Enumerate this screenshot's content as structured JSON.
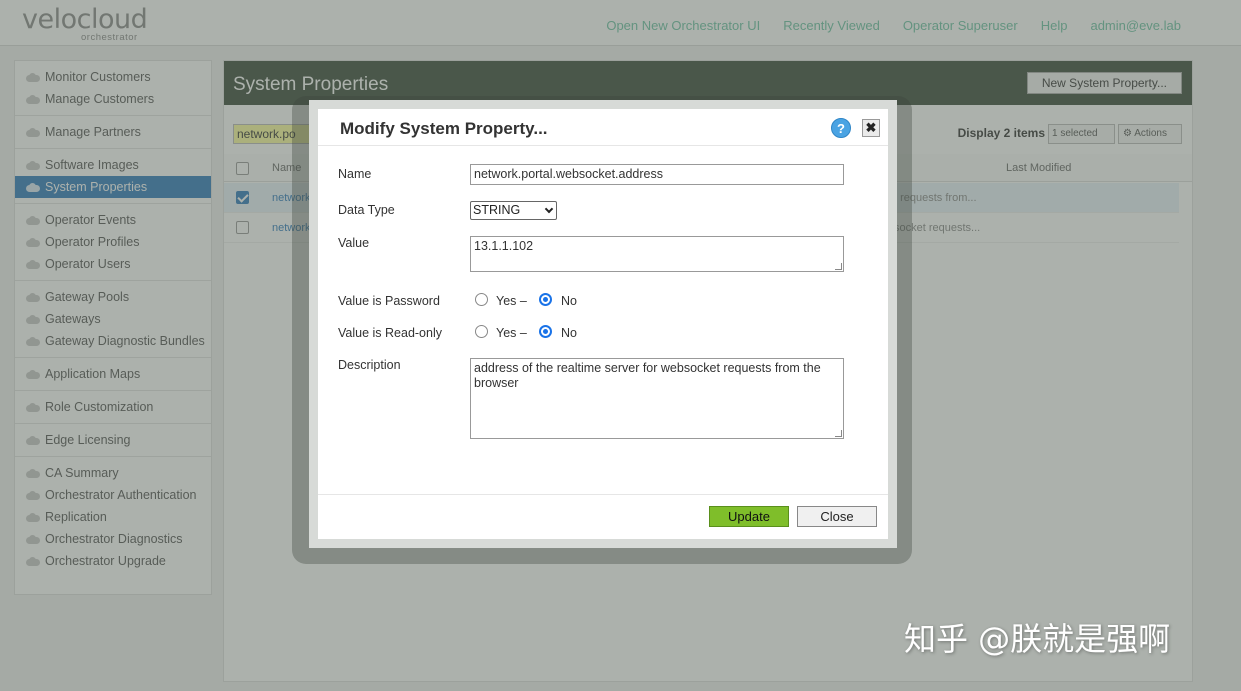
{
  "header": {
    "logo_main": "velocloud",
    "logo_sub": "orchestrator",
    "nav": [
      "Open New Orchestrator UI",
      "Recently Viewed",
      "Operator Superuser",
      "Help",
      "admin@eve.lab"
    ]
  },
  "sidebar": {
    "groups": [
      [
        "Monitor Customers",
        "Manage Customers"
      ],
      [
        "Manage Partners"
      ],
      [
        "Software Images",
        "System Properties"
      ],
      [
        "Operator Events",
        "Operator Profiles",
        "Operator Users"
      ],
      [
        "Gateway Pools",
        "Gateways",
        "Gateway Diagnostic Bundles"
      ],
      [
        "Application Maps"
      ],
      [
        "Role Customization"
      ],
      [
        "Edge Licensing"
      ],
      [
        "CA Summary",
        "Orchestrator Authentication",
        "Replication",
        "Orchestrator Diagnostics",
        "Orchestrator Upgrade"
      ]
    ],
    "active": "System Properties"
  },
  "main": {
    "title": "System Properties",
    "new_button": "New System Property...",
    "filter_value": "network.po",
    "display_count": "Display 2 items",
    "selected_label": "1 selected",
    "actions_label": "Actions",
    "columns": {
      "name": "Name",
      "last_modified": "Last Modified"
    },
    "rows": [
      {
        "name": "network",
        "desc": "t requests from...",
        "checked": true
      },
      {
        "name": "network",
        "desc": "socket requests...",
        "checked": false
      }
    ]
  },
  "modal": {
    "title": "Modify System Property...",
    "help_label": "?",
    "close_label": "✖",
    "name_label": "Name",
    "name_value": "network.portal.websocket.address",
    "data_type_label": "Data Type",
    "data_type_value": "STRING",
    "value_label": "Value",
    "value_value": "13.1.1.102",
    "password_label": "Value is Password",
    "readonly_label": "Value is Read-only",
    "yes_label": "Yes –",
    "no_label": "No",
    "password_selected": "No",
    "readonly_selected": "No",
    "description_label": "Description",
    "description_value": "address of the realtime server for websocket requests from the browser",
    "update_button": "Update",
    "close_button": "Close"
  },
  "watermark": "知乎 @朕就是强啊",
  "colors": {
    "accent": "#2f7bbd",
    "nav_link": "#6fc2a6",
    "update_btn": "#7fbe2a",
    "title_bar": "#3b4a3b"
  }
}
